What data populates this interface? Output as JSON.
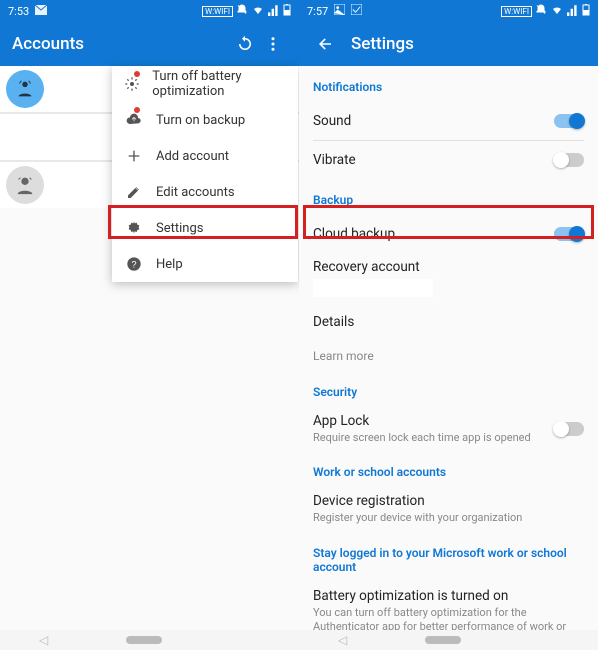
{
  "left": {
    "status_time": "7:53",
    "status_wifi": "W:WIFI",
    "app_title": "Accounts",
    "menu": {
      "battery": "Turn off battery optimization",
      "backup": "Turn on backup",
      "add": "Add account",
      "edit": "Edit accounts",
      "settings": "Settings",
      "help": "Help"
    }
  },
  "right": {
    "status_time": "7:57",
    "status_wifi": "W:WIFI",
    "app_title": "Settings",
    "sections": {
      "notifications": "Notifications",
      "backup": "Backup",
      "security": "Security",
      "work": "Work or school accounts",
      "stay": "Stay logged in to your Microsoft work or school account"
    },
    "items": {
      "sound": "Sound",
      "vibrate": "Vibrate",
      "cloud_backup": "Cloud backup",
      "recovery": "Recovery account",
      "details": "Details",
      "learn_more": "Learn more",
      "app_lock": "App Lock",
      "app_lock_sub": "Require screen lock each time app is opened",
      "device_reg": "Device registration",
      "device_reg_sub": "Register your device with your organization",
      "battery_title": "Battery optimization is turned on",
      "battery_sub": "You can turn off battery optimization for the Authenticator app for better performance of work or school apps that sync"
    }
  }
}
